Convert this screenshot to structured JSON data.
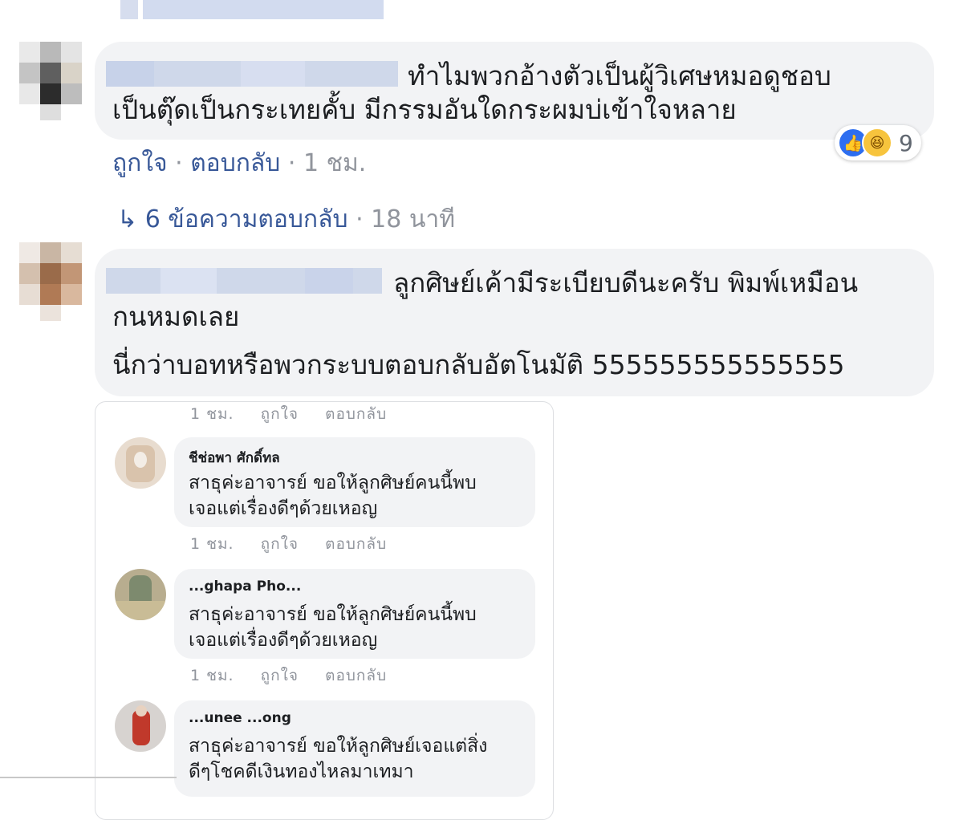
{
  "comments": [
    {
      "id": "comment-1",
      "text_line1": "ทำไมพวกอ้างตัวเป็นผู้วิเศษหมอดูชอบ",
      "text_line2": "เป็นตุ๊ดเป็นกระเทยคั้บ มีกรรมอันใดกระผมบ่เข้าใจหลาย",
      "like_label": "ถูกใจ",
      "reply_label": "ตอบกลับ",
      "time": "1 ชม.",
      "reaction_count": "9",
      "reactions": [
        "like-icon",
        "haha-icon"
      ],
      "replies_link": "6 ข้อความตอบกลับ",
      "replies_time": "18 นาที"
    },
    {
      "id": "comment-2",
      "text_line1": "ลูกศิษย์เค้ามีระเบียบดีนะครับ พิมพ์เหมือน",
      "text_line2": "กนหมดเลย",
      "text_line3": "นี่กว่าบอทหรือพวกระบบตอบกลับอัตโนมัติ 555555555555555"
    }
  ],
  "embedded": {
    "top_meta": {
      "time": "1 ชม.",
      "like": "ถูกใจ",
      "reply": "ตอบกลับ"
    },
    "replies": [
      {
        "name": "ชีช่อพา ศักดิ์ทล",
        "line1": "สาธุค่ะอาจารย์ ขอให้ลูกศิษย์คนนี้พบ",
        "line2": "เจอแต่เรื่องดีๆด้วยเหอญ",
        "time": "1 ชม.",
        "like": "ถูกใจ",
        "reply": "ตอบกลับ"
      },
      {
        "name": "...ghapa Pho...",
        "line1": "สาธุค่ะอาจารย์ ขอให้ลูกศิษย์คนนี้พบ",
        "line2": "เจอแต่เรื่องดีๆด้วยเหอญ",
        "time": "1 ชม.",
        "like": "ถูกใจ",
        "reply": "ตอบกลับ"
      },
      {
        "name": "...unee ...ong",
        "line1": "สาธุค่ะอาจารย์ ขอให้ลูกศิษย์เจอแต่สิ่ง",
        "line2": "ดีๆโชคดีเงินทองไหลมาเทมา"
      }
    ]
  },
  "colors": {
    "bubble": "#f2f3f5",
    "link": "#385898",
    "meta_gray": "#90949c",
    "like_blue": "#2d6ef0",
    "haha_yellow": "#f7c43d"
  }
}
